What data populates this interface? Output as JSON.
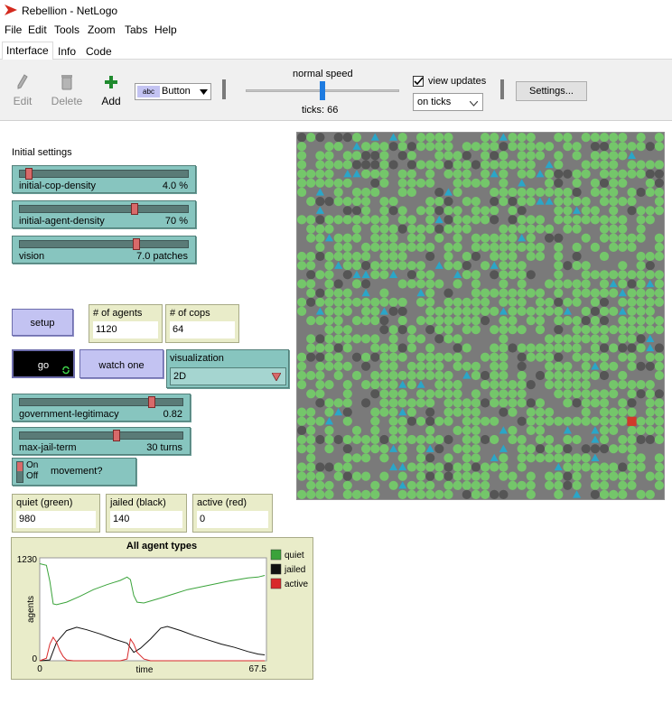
{
  "window": {
    "title": "Rebellion - NetLogo"
  },
  "menu": [
    "File",
    "Edit",
    "Tools",
    "Zoom",
    "Tabs",
    "Help"
  ],
  "tabs": [
    "Interface",
    "Info",
    "Code"
  ],
  "toolbar": {
    "edit": "Edit",
    "delete": "Delete",
    "add": "Add",
    "widget_type": "Button",
    "speed_label": "normal speed",
    "speed_value": 0.5,
    "ticks": "ticks: 66",
    "view_updates": "view updates",
    "update_mode": "on ticks",
    "settings": "Settings..."
  },
  "interface": {
    "initial_settings": "Initial settings",
    "sliders": [
      {
        "label": "initial-cop-density",
        "value": "4.0 %",
        "frac": 0.04
      },
      {
        "label": "initial-agent-density",
        "value": "70 %",
        "frac": 0.69
      },
      {
        "label": "vision",
        "value": "7.0 patches",
        "frac": 0.7
      }
    ],
    "setup": "setup",
    "go": "go",
    "watch_one": "watch one",
    "agents_monitor": {
      "label": "# of agents",
      "value": "1120"
    },
    "cops_monitor": {
      "label": "# of cops",
      "value": "64"
    },
    "visualization": {
      "label": "visualization",
      "value": "2D"
    },
    "sliders2": [
      {
        "label": "government-legitimacy",
        "value": "0.82",
        "frac": 0.82
      },
      {
        "label": "max-jail-term",
        "value": "30 turns",
        "frac": 0.6
      }
    ],
    "switch": {
      "on": "On",
      "off": "Off",
      "label": "movement?"
    },
    "quiet_monitor": {
      "label": "quiet (green)",
      "value": "980"
    },
    "jailed_monitor": {
      "label": "jailed (black)",
      "value": "140"
    },
    "active_monitor": {
      "label": "active (red)",
      "value": "0"
    }
  },
  "colors": {
    "quiet": "#74c66a",
    "jailed": "#555555",
    "active": "#d03a2a",
    "cop": "#2aa6c8",
    "patch": "#7a7a7a",
    "teal": "#87c5bf",
    "button": "#c3c3f2",
    "monitor": "#e9ecc9"
  },
  "chart_data": {
    "type": "line",
    "title": "All agent types",
    "xlabel": "time",
    "ylabel": "agents",
    "xlim": [
      0,
      67.5
    ],
    "ylim": [
      0,
      1230
    ],
    "x_tick_labels": [
      "0",
      "67.5"
    ],
    "y_tick_labels": [
      "0",
      "1230"
    ],
    "legend": "right",
    "series": [
      {
        "name": "quiet",
        "color": "#3aa33a",
        "points": [
          [
            0,
            1160
          ],
          [
            2,
            1140
          ],
          [
            3,
            950
          ],
          [
            4,
            680
          ],
          [
            5,
            670
          ],
          [
            8,
            700
          ],
          [
            12,
            770
          ],
          [
            16,
            850
          ],
          [
            20,
            910
          ],
          [
            24,
            960
          ],
          [
            26,
            1000
          ],
          [
            27,
            970
          ],
          [
            28,
            780
          ],
          [
            29,
            700
          ],
          [
            31,
            690
          ],
          [
            36,
            750
          ],
          [
            40,
            800
          ],
          [
            44,
            850
          ],
          [
            50,
            900
          ],
          [
            56,
            950
          ],
          [
            62,
            990
          ],
          [
            65,
            1000
          ],
          [
            67,
            1020
          ]
        ]
      },
      {
        "name": "jailed",
        "color": "#111111",
        "points": [
          [
            0,
            0
          ],
          [
            3,
            10
          ],
          [
            5,
            220
          ],
          [
            8,
            360
          ],
          [
            11,
            400
          ],
          [
            14,
            370
          ],
          [
            18,
            320
          ],
          [
            22,
            260
          ],
          [
            26,
            210
          ],
          [
            28,
            100
          ],
          [
            30,
            150
          ],
          [
            33,
            260
          ],
          [
            36,
            390
          ],
          [
            38,
            410
          ],
          [
            42,
            360
          ],
          [
            46,
            300
          ],
          [
            50,
            250
          ],
          [
            54,
            200
          ],
          [
            58,
            160
          ],
          [
            62,
            110
          ],
          [
            65,
            80
          ],
          [
            67,
            70
          ]
        ]
      },
      {
        "name": "active",
        "color": "#d8292a",
        "points": [
          [
            0,
            0
          ],
          [
            2,
            30
          ],
          [
            3,
            200
          ],
          [
            4,
            280
          ],
          [
            5,
            220
          ],
          [
            6,
            120
          ],
          [
            7,
            50
          ],
          [
            8,
            10
          ],
          [
            10,
            0
          ],
          [
            24,
            0
          ],
          [
            26,
            20
          ],
          [
            27,
            260
          ],
          [
            28,
            200
          ],
          [
            29,
            100
          ],
          [
            31,
            20
          ],
          [
            33,
            0
          ],
          [
            67,
            0
          ]
        ]
      }
    ]
  }
}
